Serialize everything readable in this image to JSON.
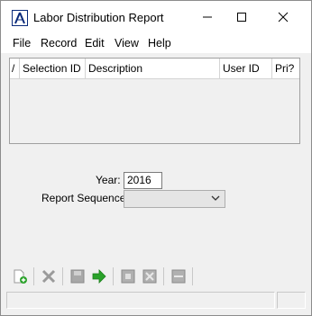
{
  "window": {
    "title": "Labor Distribution Report"
  },
  "menu": {
    "items": [
      "File",
      "Record",
      "Edit",
      "View",
      "Help"
    ]
  },
  "grid": {
    "columns": [
      "/",
      "Selection ID",
      "Description",
      "User ID",
      "Pri?"
    ]
  },
  "form": {
    "year_label": "Year:",
    "year_value": "2016",
    "sequence_label": "Report Sequence:",
    "sequence_value": ""
  },
  "toolbar": {
    "icons": [
      "new-record-icon",
      "delete-icon",
      "save-icon",
      "go-arrow-icon",
      "copy-icon",
      "clear-icon",
      "options-icon"
    ]
  },
  "colors": {
    "window_bg": "#f0f0f0",
    "accent_green": "#2aa22a",
    "icon_gray": "#9a9a9a",
    "logo_blue": "#0a2a7a"
  }
}
